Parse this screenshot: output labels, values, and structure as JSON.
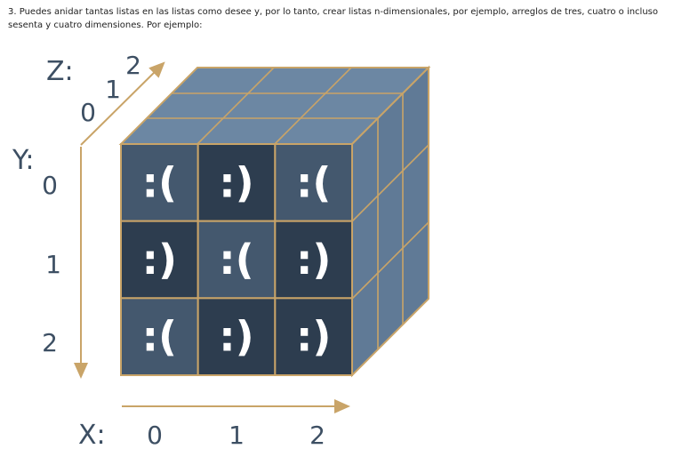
{
  "intro_text": "3. Puedes anidar tantas listas en las listas como desee y, por lo tanto, crear listas n-dimensionales, por ejemplo, arreglos de tres, cuatro o incluso sesenta y cuatro dimensiones. Por ejemplo:",
  "axes": {
    "z": {
      "label": "Z:",
      "ticks": [
        "0",
        "1",
        "2"
      ]
    },
    "y": {
      "label": "Y:",
      "ticks": [
        "0",
        "1",
        "2"
      ]
    },
    "x": {
      "label": "X:",
      "ticks": [
        "0",
        "1",
        "2"
      ]
    }
  },
  "front_face": [
    [
      ":(",
      ":)",
      ":("
    ],
    [
      ":)",
      ":(",
      ":)"
    ],
    [
      ":(",
      ":)",
      ":)"
    ]
  ],
  "colors": {
    "sad_cell": "#44586e",
    "happy_cell": "#2d3d4f",
    "top_face": "#6c87a3",
    "side_face": "#607a96",
    "edge": "#c9a468",
    "arrow": "#c9a468",
    "label": "#3d4f63"
  }
}
